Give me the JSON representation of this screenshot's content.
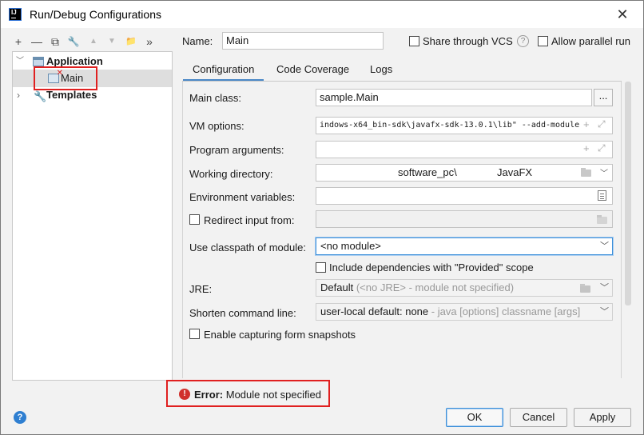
{
  "window": {
    "title": "Run/Debug Configurations",
    "close_glyph": "✕"
  },
  "toolbar": {
    "add": "+",
    "remove": "—",
    "copy": "⧉",
    "edit": "🔧",
    "up": "▲",
    "down": "▼",
    "folder": "📁",
    "more": "»"
  },
  "tree": {
    "application_label": "Application",
    "main_label": "Main",
    "templates_label": "Templates"
  },
  "name_row": {
    "name_label": "Name:",
    "name_value": "Main",
    "share_label": "Share through VCS",
    "parallel_label": "Allow parallel run"
  },
  "tabs": [
    "Configuration",
    "Code Coverage",
    "Logs"
  ],
  "form": {
    "main_class_label": "Main class:",
    "main_class_value": "sample.Main",
    "browse_label": "...",
    "vm_options_label": "VM options:",
    "vm_options_value": "indows-x64_bin-sdk\\javafx-sdk-13.0.1\\lib\" --add-module",
    "program_args_label": "Program arguments:",
    "working_dir_label": "Working directory:",
    "working_dir_part1": "software_pc\\",
    "working_dir_part2": "JavaFX",
    "env_vars_label": "Environment variables:",
    "redirect_label": "Redirect input from:",
    "classpath_label": "Use classpath of module:",
    "classpath_value": "<no module>",
    "include_deps_label": "Include dependencies with \"Provided\" scope",
    "jre_label": "JRE:",
    "jre_value_main": "Default",
    "jre_value_muted": "(<no JRE> - module not specified)",
    "shorten_label": "Shorten command line:",
    "shorten_value_main": "user-local default: none",
    "shorten_value_muted": "- java [options] classname [args]",
    "snapshots_label": "Enable capturing form snapshots"
  },
  "error": {
    "prefix": "Error:",
    "message": "Module not specified"
  },
  "buttons": {
    "ok": "OK",
    "cancel": "Cancel",
    "apply": "Apply",
    "help": "?"
  },
  "colors": {
    "accent": "#3c8fd9",
    "error": "#e02020",
    "tab_underline": "#4a88c7"
  }
}
